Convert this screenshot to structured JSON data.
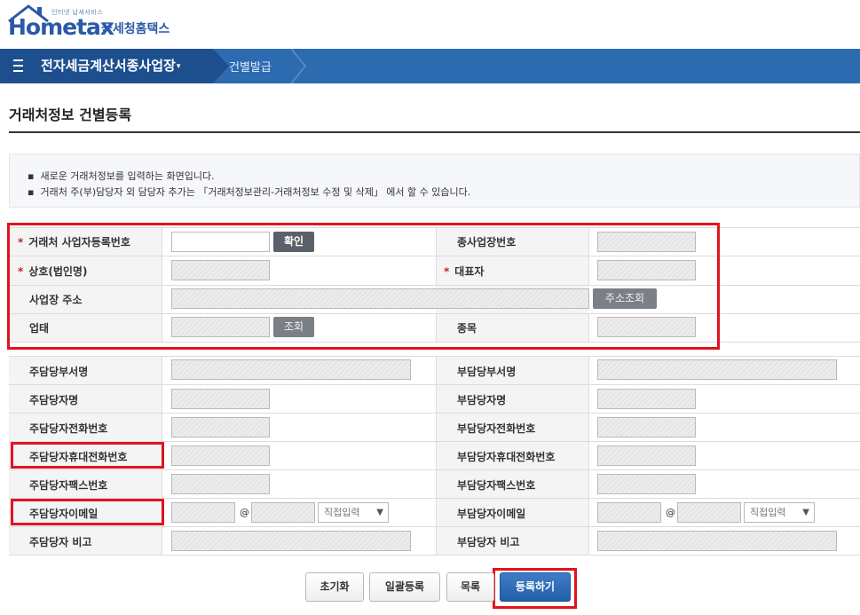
{
  "header": {
    "logo_tagline": "인터넷 납세서비스",
    "logo_text": "Hometax",
    "logo_sub": "국세청홈택스"
  },
  "nav": {
    "title": "전자세금계산서종사업장",
    "crumb": "건별발급"
  },
  "page": {
    "title": "거래처정보 건별등록"
  },
  "info": {
    "line1": "새로운 거래처정보를 입력하는 화면입니다.",
    "line2": "거래처 주(부)담당자 외 담당자 추가는 「거래처정보관리-거래처정보 수정 및 삭제」 에서 할 수 있습니다."
  },
  "form": {
    "biz_no_label": "거래처 사업자등록번호",
    "confirm_button": "확인",
    "sub_biz_no_label": "종사업장번호",
    "company_label": "상호(법인명)",
    "ceo_label": "대표자",
    "address_label": "사업장 주소",
    "address_search_button": "주소조회",
    "biz_type_label": "업태",
    "biz_type_search_button": "조회",
    "biz_item_label": "종목",
    "required_mark": "*"
  },
  "contacts": {
    "main_dept_label": "주담당부서명",
    "sub_dept_label": "부담당부서명",
    "main_name_label": "주담당자명",
    "sub_name_label": "부담당자명",
    "main_phone_label": "주담당자전화번호",
    "sub_phone_label": "부담당자전화번호",
    "main_mobile_label": "주담당자휴대전화번호",
    "sub_mobile_label": "부담당자휴대전화번호",
    "main_fax_label": "주담당자팩스번호",
    "sub_fax_label": "부담당자팩스번호",
    "main_email_label": "주담당자이메일",
    "sub_email_label": "부담당자이메일",
    "at_sign": "@",
    "email_domain_select": "직접입력",
    "main_note_label": "주담당자 비고",
    "sub_note_label": "부담당자 비고"
  },
  "buttons": {
    "reset": "초기화",
    "bulk": "일괄등록",
    "list": "목록",
    "register": "등록하기"
  },
  "colors": {
    "nav_blue": "#2d6bb1",
    "nav_dark": "#1d4f8f",
    "highlight_red": "#e0141e",
    "primary_button": "#225ea8"
  }
}
